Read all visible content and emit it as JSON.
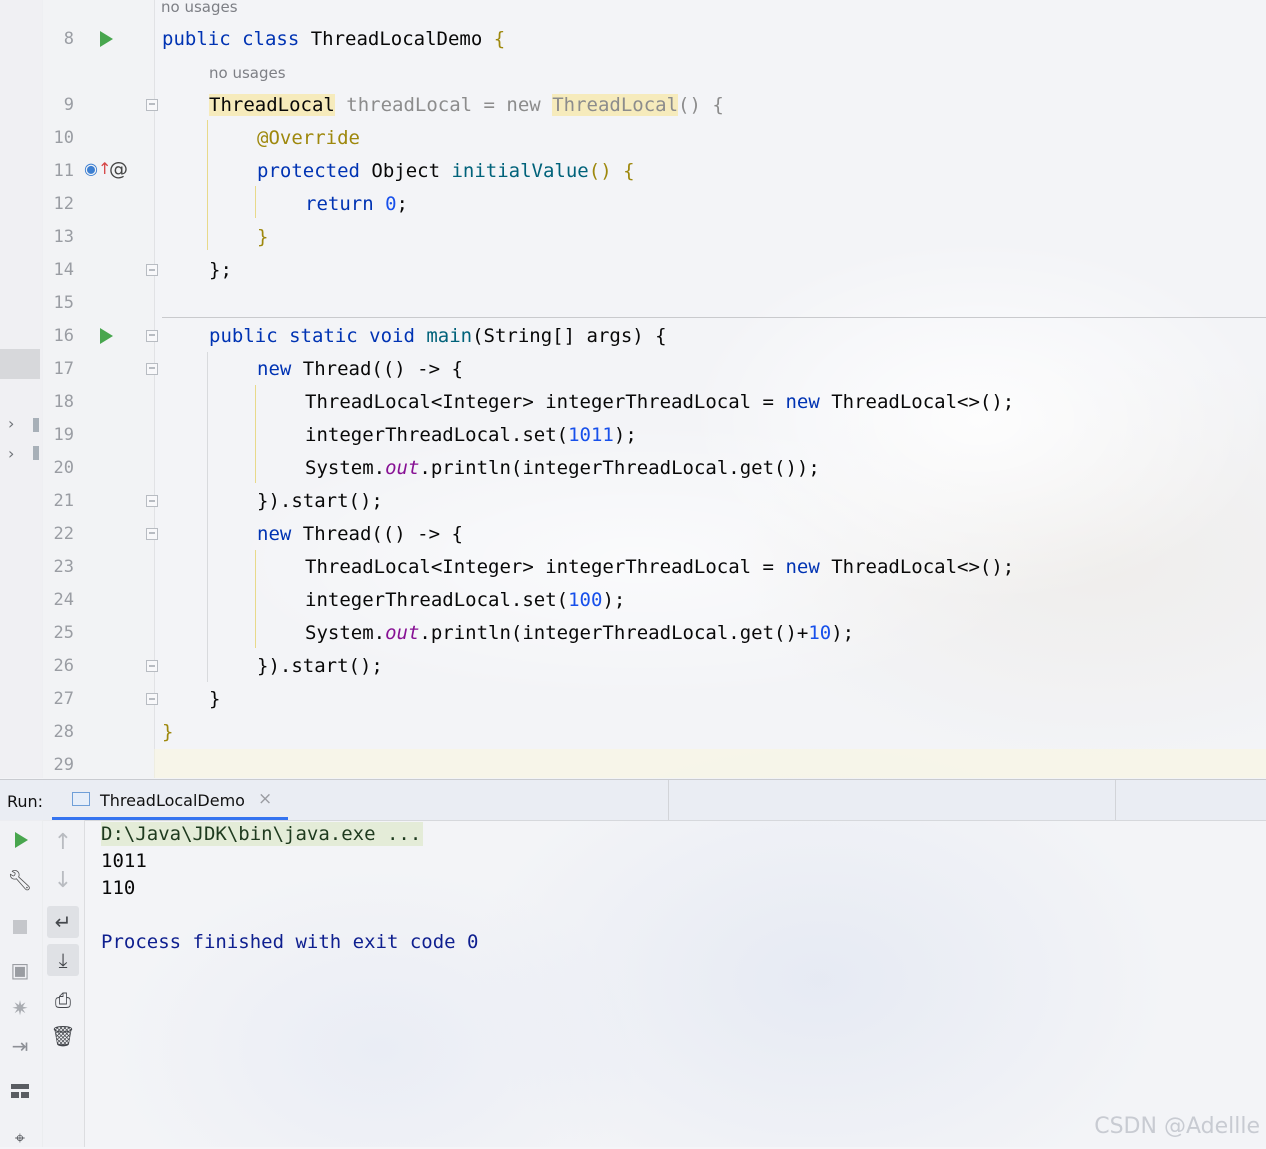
{
  "editor": {
    "hints": {
      "line8": "no usages",
      "line9": "no usages"
    },
    "line_numbers": [
      "8",
      "9",
      "10",
      "11",
      "12",
      "13",
      "14",
      "15",
      "16",
      "17",
      "18",
      "19",
      "20",
      "21",
      "22",
      "23",
      "24",
      "25",
      "26",
      "27",
      "28",
      "29"
    ],
    "code": {
      "l8_a": "public class ",
      "l8_b": "ThreadLocalDemo ",
      "l8_c": "{",
      "l9_a": "ThreadLocal",
      "l9_b": " threadLocal = new ",
      "l9_c": "ThreadLocal",
      "l9_d": "() {",
      "l10": "@Override",
      "l11_a": "protected ",
      "l11_b": "Object ",
      "l11_c": "initialValue",
      "l11_d": "() {",
      "l12_a": "return ",
      "l12_b": "0",
      "l12_c": ";",
      "l13": "}",
      "l14": "};",
      "l16_a": "public static void ",
      "l16_b": "main",
      "l16_c": "(String[] args) {",
      "l17_a": "new ",
      "l17_b": "Thread(() -> {",
      "l18_a": "ThreadLocal<Integer> integerThreadLocal = ",
      "l18_b": "new ",
      "l18_c": "ThreadLocal<>();",
      "l19_a": "integerThreadLocal.set(",
      "l19_b": "1011",
      "l19_c": ");",
      "l20_a": "System.",
      "l20_b": "out",
      "l20_c": ".println(integerThreadLocal.get());",
      "l21": "}).start();",
      "l22_a": "new ",
      "l22_b": "Thread(() -> {",
      "l23_a": "ThreadLocal<Integer> integerThreadLocal = ",
      "l23_b": "new ",
      "l23_c": "ThreadLocal<>();",
      "l24_a": "integerThreadLocal.set(",
      "l24_b": "100",
      "l24_c": ");",
      "l25_a": "System.",
      "l25_b": "out",
      "l25_c": ".println(integerThreadLocal.get()+",
      "l25_d": "10",
      "l25_e": ");",
      "l26": "}).start();",
      "l27": "}",
      "l28": "}"
    }
  },
  "run_panel": {
    "label": "Run:",
    "tab_label": "ThreadLocalDemo",
    "tab_close": "×",
    "console": {
      "command": "D:\\Java\\JDK\\bin\\java.exe ...",
      "line1": "1011",
      "line2": "110",
      "finished": "Process finished with exit code 0"
    }
  },
  "icons": {
    "run": "run-icon",
    "wrench": "wrench-icon",
    "stop": "stop-icon",
    "camera": "camera-icon",
    "debug": "debug-icon",
    "exit": "exit-icon",
    "layout": "layout-icon",
    "pin": "pin-icon",
    "up": "arrow-up-icon",
    "down": "arrow-down-icon",
    "soft_wrap": "soft-wrap-icon",
    "scroll_end": "scroll-to-end-icon",
    "print": "print-icon",
    "trash": "trash-icon"
  },
  "watermark": "CSDN @Adellle",
  "colors": {
    "keyword": "#0033b3",
    "number": "#1750eb",
    "annotation": "#9e880d",
    "run_green": "#48a64e",
    "accent": "#3574f0"
  }
}
